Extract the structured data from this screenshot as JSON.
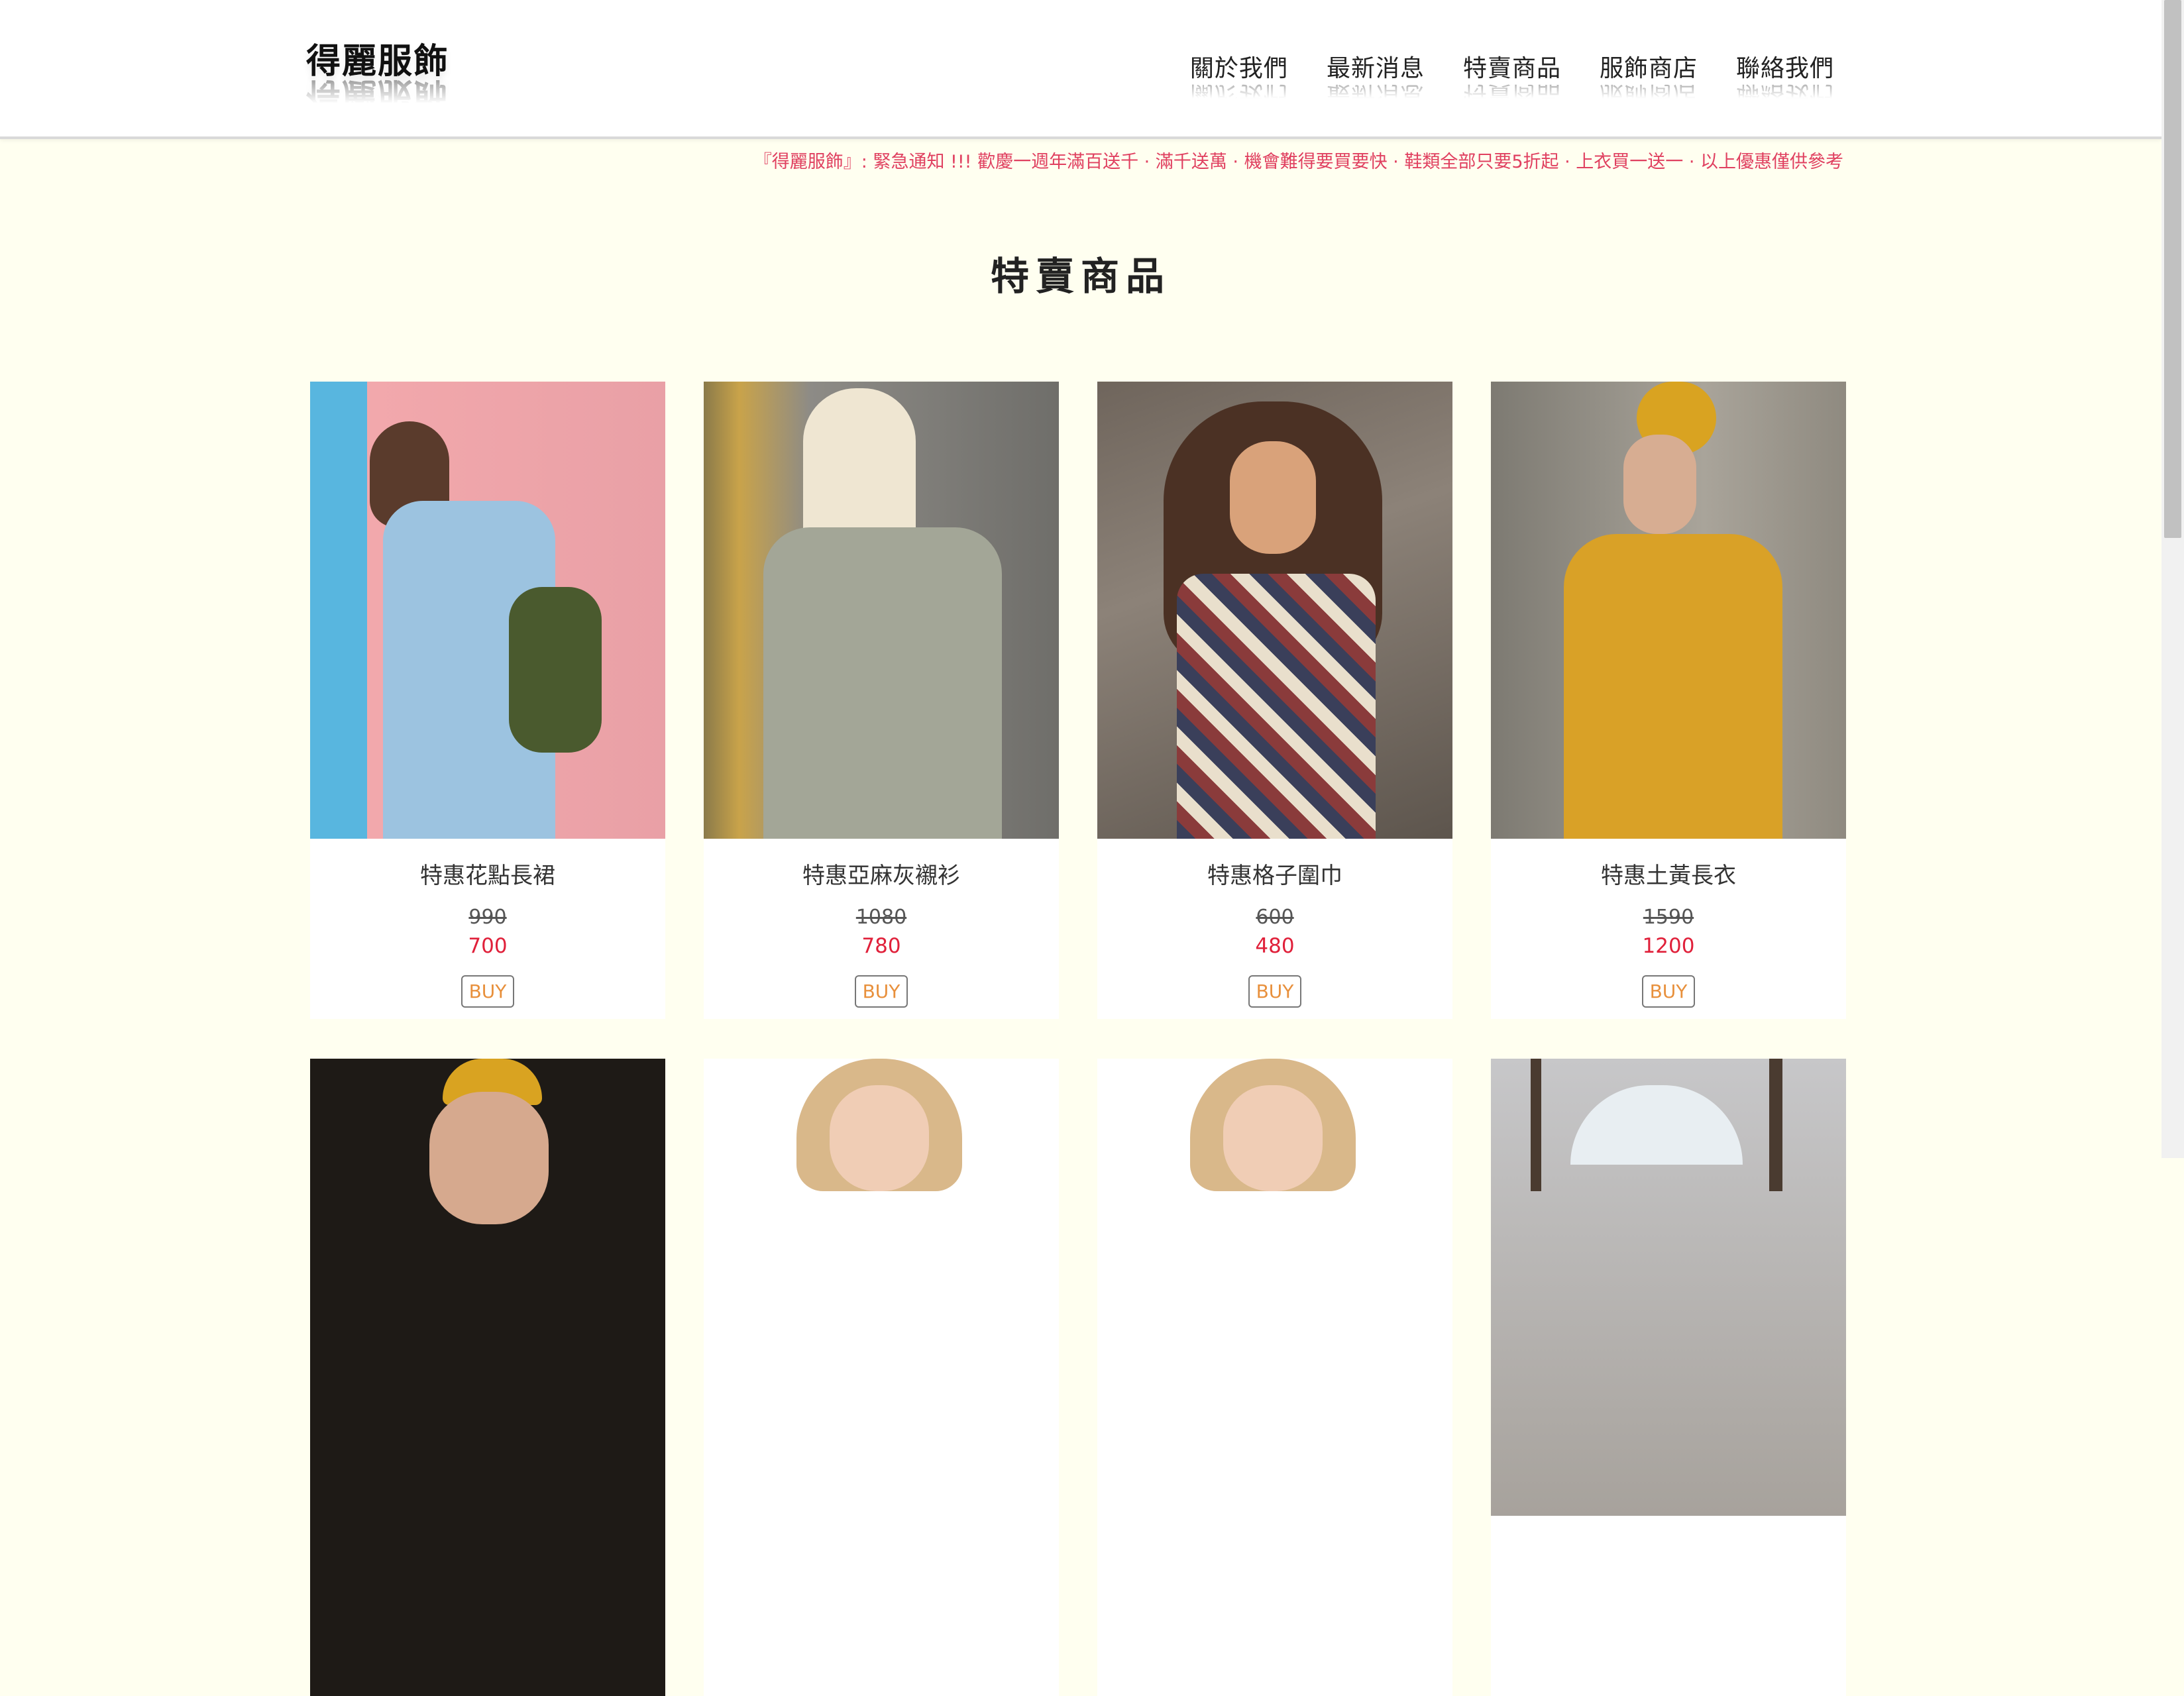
{
  "header": {
    "logo": "得麗服飾",
    "nav": [
      "關於我們",
      "最新消息",
      "特賣商品",
      "服飾商店",
      "聯絡我們"
    ]
  },
  "announcement": "『得麗服飾』: 緊急通知 !!! 歡慶一週年滿百送千 · 滿千送萬 · 機會難得要買要快 · 鞋類全部只要5折起 · 上衣買一送一 · 以上優惠僅供參考",
  "section": {
    "title": "特賣商品"
  },
  "products": [
    {
      "name": "特惠花點長裙",
      "old_price": "990",
      "price": "700",
      "buy": "BUY"
    },
    {
      "name": "特惠亞麻灰襯衫",
      "old_price": "1080",
      "price": "780",
      "buy": "BUY"
    },
    {
      "name": "特惠格子圍巾",
      "old_price": "600",
      "price": "480",
      "buy": "BUY"
    },
    {
      "name": "特惠土黃長衣",
      "old_price": "1590",
      "price": "1200",
      "buy": "BUY"
    }
  ],
  "colors": {
    "background": "#fffff0",
    "accent_red": "#e0203a",
    "buy_orange": "#e8903c"
  }
}
